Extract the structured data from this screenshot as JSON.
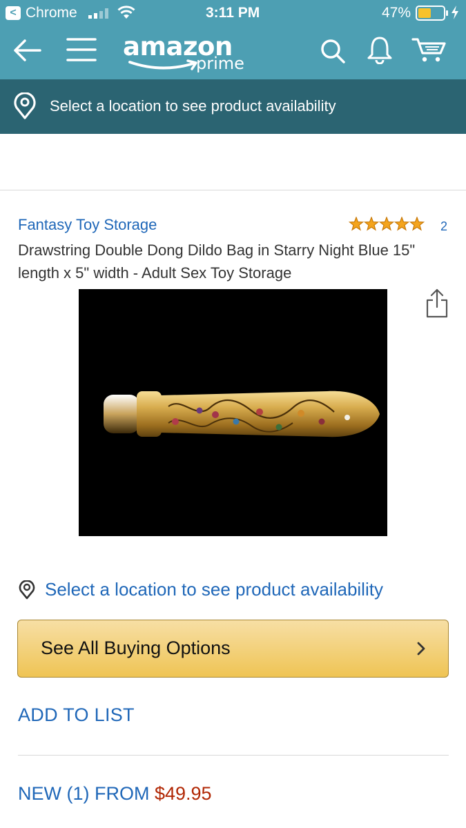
{
  "status_bar": {
    "back_app": "Chrome",
    "time": "3:11 PM",
    "battery": "47%"
  },
  "nav": {
    "logo_text": "amazon",
    "logo_sub": "prime",
    "icons": [
      "back-arrow-icon",
      "menu-icon",
      "search-icon",
      "bell-icon",
      "cart-icon"
    ]
  },
  "location_bar": {
    "text": "Select a location to see product availability"
  },
  "product": {
    "brand": "Fantasy Toy Storage",
    "rating": 5,
    "review_count": "2",
    "title": "Drawstring Double Dong Dildo Bag in Starry Night Blue 15\" length x 5\" width - Adult Sex Toy Storage"
  },
  "location_link": "Select a location to see product availability",
  "buy_button": "See All Buying Options",
  "add_to_list": "ADD TO LIST",
  "offers": {
    "label": "NEW (1) FROM ",
    "price": "$49.95"
  },
  "colors": {
    "header": "#4d9fb3",
    "location_bar": "#2b6472",
    "link": "#1f67b8",
    "price": "#b12704",
    "button": "#efc454"
  }
}
